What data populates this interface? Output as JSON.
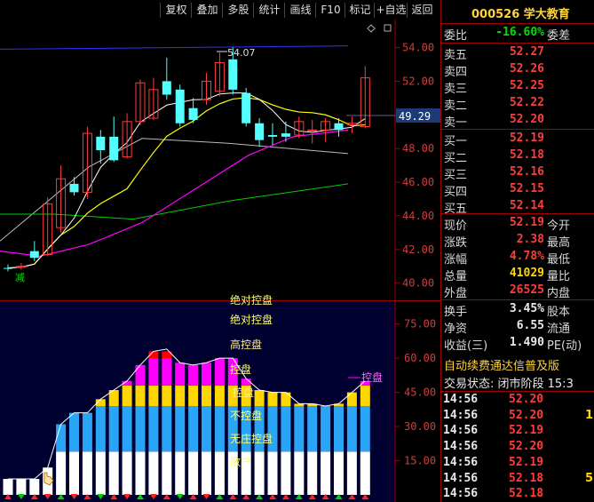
{
  "toolbar": {
    "buttons": [
      "复权",
      "叠加",
      "多股",
      "统计",
      "画线",
      "F10",
      "标记",
      "+自选",
      "返回"
    ]
  },
  "stock": {
    "code": "000526",
    "name": "学大教育",
    "full": "000526 学大教育"
  },
  "quote": {
    "weibi_label": "委比",
    "weibi_value": "-16.60%",
    "weicha_label": "委差",
    "asks": [
      {
        "label": "卖五",
        "price": "52.27"
      },
      {
        "label": "卖四",
        "price": "52.26"
      },
      {
        "label": "卖三",
        "price": "52.25"
      },
      {
        "label": "卖二",
        "price": "52.22"
      },
      {
        "label": "卖一",
        "price": "52.20"
      }
    ],
    "bids": [
      {
        "label": "买一",
        "price": "52.19"
      },
      {
        "label": "买二",
        "price": "52.18"
      },
      {
        "label": "买三",
        "price": "52.16"
      },
      {
        "label": "买四",
        "price": "52.15"
      },
      {
        "label": "买五",
        "price": "52.14"
      }
    ],
    "stats": [
      {
        "label": "现价",
        "value": "52.19",
        "label2": "今开",
        "color": "red"
      },
      {
        "label": "涨跌",
        "value": "2.38",
        "label2": "最高",
        "color": "red"
      },
      {
        "label": "涨幅",
        "value": "4.78%",
        "label2": "最低",
        "color": "red"
      },
      {
        "label": "总量",
        "value": "41029",
        "label2": "量比",
        "color": "yellow"
      },
      {
        "label": "外盘",
        "value": "26525",
        "label2": "内盘",
        "color": "red"
      }
    ],
    "stats2": [
      {
        "label": "换手",
        "value": "3.45%",
        "label2": "股本",
        "color": "white"
      },
      {
        "label": "净资",
        "value": "6.55",
        "label2": "流通",
        "color": "white"
      },
      {
        "label": "收益(三)",
        "value": "1.490",
        "label2": "PE(动)",
        "color": "white"
      }
    ],
    "ad_text": "自动续费通达信普及版",
    "status_text": "交易状态: 闭市阶段 15:3"
  },
  "trades": [
    {
      "time": "14:56",
      "price": "52.20",
      "vol": ""
    },
    {
      "time": "14:56",
      "price": "52.20",
      "vol": "1"
    },
    {
      "time": "14:56",
      "price": "52.19",
      "vol": ""
    },
    {
      "time": "14:56",
      "price": "52.20",
      "vol": ""
    },
    {
      "time": "14:56",
      "price": "52.19",
      "vol": ""
    },
    {
      "time": "14:56",
      "price": "52.18",
      "vol": "5"
    },
    {
      "time": "14:56",
      "price": "52.18",
      "vol": ""
    }
  ],
  "chart_data": [
    {
      "type": "candlestick",
      "y_ticks": [
        "54.00",
        "52.00",
        "50.00",
        "48.00",
        "46.00",
        "44.00",
        "42.00",
        "40.00"
      ],
      "ylim": [
        39.4,
        55.4
      ],
      "current_price_label": "49.29",
      "high_label": "54.07",
      "candles": [
        {
          "o": 40.9,
          "c": 40.9,
          "h": 41.1,
          "l": 40.7,
          "up": false
        },
        {
          "o": 41.0,
          "c": 41.0,
          "h": 41.2,
          "l": 40.8,
          "up": true
        },
        {
          "o": 41.9,
          "c": 41.5,
          "h": 42.5,
          "l": 41.3,
          "up": false
        },
        {
          "o": 41.7,
          "c": 44.7,
          "h": 45.1,
          "l": 41.6,
          "up": true
        },
        {
          "o": 43.3,
          "c": 46.2,
          "h": 47.0,
          "l": 43.0,
          "up": true
        },
        {
          "o": 45.4,
          "c": 45.9,
          "h": 46.3,
          "l": 45.2,
          "up": false
        },
        {
          "o": 45.4,
          "c": 48.9,
          "h": 49.3,
          "l": 45.0,
          "up": true
        },
        {
          "o": 47.9,
          "c": 48.7,
          "h": 49.1,
          "l": 47.1,
          "up": false
        },
        {
          "o": 47.3,
          "c": 48.7,
          "h": 49.9,
          "l": 47.2,
          "up": false
        },
        {
          "o": 47.5,
          "c": 49.6,
          "h": 50.1,
          "l": 47.4,
          "up": true
        },
        {
          "o": 49.6,
          "c": 51.9,
          "h": 52.1,
          "l": 49.4,
          "up": true
        },
        {
          "o": 49.8,
          "c": 51.5,
          "h": 52.2,
          "l": 49.7,
          "up": true
        },
        {
          "o": 52.0,
          "c": 51.2,
          "h": 53.4,
          "l": 50.9,
          "up": false
        },
        {
          "o": 51.5,
          "c": 49.5,
          "h": 51.8,
          "l": 49.3,
          "up": false
        },
        {
          "o": 49.7,
          "c": 50.4,
          "h": 51.0,
          "l": 49.5,
          "up": false
        },
        {
          "o": 50.9,
          "c": 52.0,
          "h": 52.5,
          "l": 50.6,
          "up": true
        },
        {
          "o": 51.4,
          "c": 53.1,
          "h": 53.7,
          "l": 51.1,
          "up": true
        },
        {
          "o": 53.3,
          "c": 51.5,
          "h": 54.0,
          "l": 51.2,
          "up": false
        },
        {
          "o": 51.3,
          "c": 49.5,
          "h": 51.6,
          "l": 49.3,
          "up": false
        },
        {
          "o": 49.5,
          "c": 48.5,
          "h": 49.8,
          "l": 48.1,
          "up": false
        },
        {
          "o": 48.8,
          "c": 48.7,
          "h": 49.5,
          "l": 48.2,
          "up": false
        },
        {
          "o": 48.7,
          "c": 48.9,
          "h": 49.6,
          "l": 48.4,
          "up": false
        },
        {
          "o": 48.8,
          "c": 49.6,
          "h": 49.9,
          "l": 48.6,
          "up": true
        },
        {
          "o": 49.1,
          "c": 49.1,
          "h": 49.7,
          "l": 48.3,
          "up": true
        },
        {
          "o": 49.6,
          "c": 49.1,
          "h": 49.8,
          "l": 48.4,
          "up": true
        },
        {
          "o": 49.5,
          "c": 49.1,
          "h": 49.8,
          "l": 48.7,
          "up": false
        },
        {
          "o": 49.5,
          "c": 49.4,
          "h": 49.9,
          "l": 48.9,
          "up": true
        },
        {
          "o": 49.3,
          "c": 52.2,
          "h": 52.9,
          "l": 49.2,
          "up": true
        }
      ]
    },
    {
      "type": "stacked-bar",
      "y_ticks": [
        "75.00",
        "60.00",
        "45.00",
        "30.00",
        "15.00"
      ],
      "ylim": [
        0,
        85
      ],
      "levels": [
        {
          "name": "绝对控盘",
          "color": "#ff0000"
        },
        {
          "name": "高控盘",
          "color": "#ff00ff"
        },
        {
          "name": "控盘",
          "color": "#ffd700"
        },
        {
          "name": "不控盘",
          "color": "#2aa4f4"
        },
        {
          "name": "无庄控盘",
          "color": "#ffffff"
        }
      ],
      "other_labels": [
        "散户"
      ],
      "tail_label": "控盘",
      "values": [
        7,
        7,
        7,
        12,
        31,
        36,
        36,
        42,
        46,
        50,
        57,
        63,
        64,
        58,
        57,
        58,
        60,
        60,
        51,
        46,
        45,
        45,
        40,
        40,
        39,
        40,
        45,
        50
      ]
    }
  ],
  "colors": {
    "up": "#ff3c3c",
    "down": "#54ffff",
    "grid": "#a00000",
    "ma5": "#ffffff",
    "ma10": "#ffff00",
    "ma20": "#ff00ff",
    "ma60": "#00d000",
    "ma_ref": "#3030ff"
  }
}
